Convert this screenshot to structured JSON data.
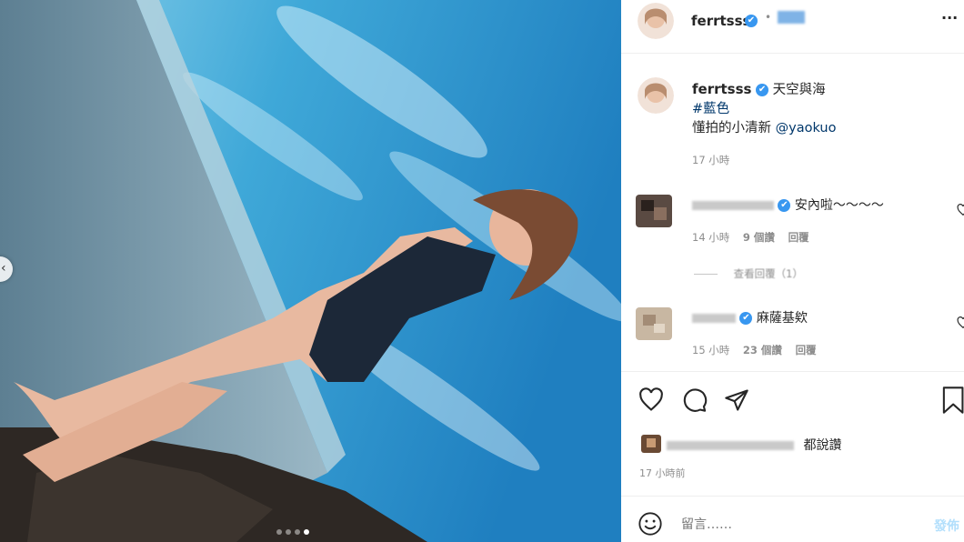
{
  "post": {
    "username": "ferrtsss",
    "verified_mark": "✔",
    "follow_dot": "•",
    "more_label": "···",
    "caption_title": "天空與海",
    "hashtag": "#藍色",
    "caption_line": "懂拍的小清新",
    "mention": "@yaokuo",
    "caption_time": "17 小時"
  },
  "comments": [
    {
      "text": "安內啦～～～～",
      "time": "14 小時",
      "likes": "9 個讚",
      "reply_label": "回覆",
      "view_replies": "查看回覆（1）"
    },
    {
      "text": "麻薩基欸",
      "time": "15 小時",
      "likes": "23 個讚",
      "reply_label": "回覆"
    }
  ],
  "actions": {
    "likes_suffix": "都說讚",
    "timestamp": "17 小時前"
  },
  "composer": {
    "placeholder": "留言……",
    "post_label": "發佈"
  },
  "carousel": {
    "slides": 4,
    "active": 4
  }
}
